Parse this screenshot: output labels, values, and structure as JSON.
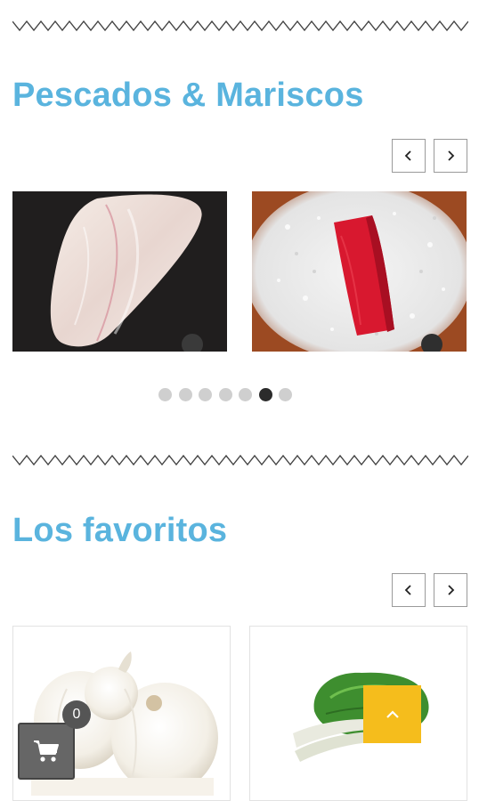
{
  "sections": [
    {
      "title": "Pescados & Mariscos",
      "prev_icon": "chevron-left-icon",
      "next_icon": "chevron-right-icon",
      "products": [
        {
          "name": "fish-fillet"
        },
        {
          "name": "red-tuna-on-salt"
        }
      ],
      "pagination": {
        "count": 7,
        "active": 6
      }
    },
    {
      "title": "Los favoritos",
      "prev_icon": "chevron-left-icon",
      "next_icon": "chevron-right-icon",
      "products": [
        {
          "name": "white-onions"
        },
        {
          "name": "chard-leeks"
        }
      ]
    }
  ],
  "cart": {
    "count": "0",
    "icon": "cart-icon"
  },
  "scroll_top": {
    "icon": "chevron-up-icon"
  },
  "colors": {
    "title": "#5ab4de",
    "accent": "#f5bd1c",
    "cart": "#666666"
  }
}
